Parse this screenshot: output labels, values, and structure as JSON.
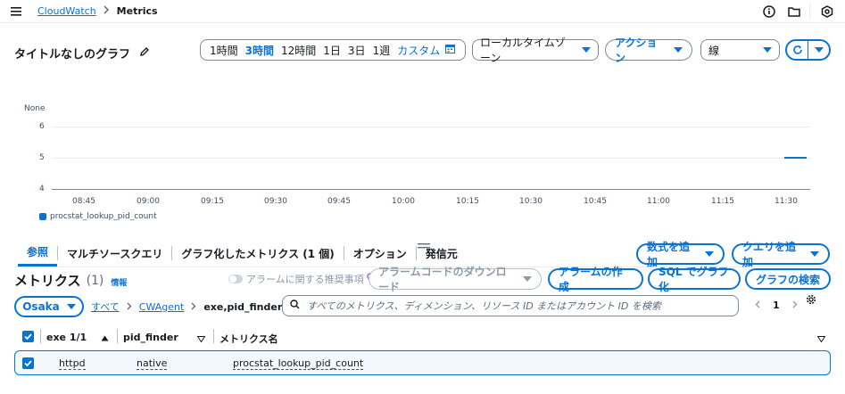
{
  "breadcrumb": {
    "root": "CloudWatch",
    "current": "Metrics"
  },
  "graph": {
    "title": "タイトルなしのグラフ",
    "time_ranges": [
      "1時間",
      "3時間",
      "12時間",
      "1日",
      "3日",
      "1週"
    ],
    "active_range": "3時間",
    "custom_label": "カスタム",
    "timezone": "ローカルタイムゾーン",
    "actions_label": "アクション",
    "chart_type": "線"
  },
  "chart_data": {
    "type": "line",
    "ylabel": "None",
    "y_ticks": [
      "6",
      "5",
      "4"
    ],
    "ylim": [
      4,
      6
    ],
    "x_ticks": [
      "08:45",
      "09:00",
      "09:15",
      "09:30",
      "09:45",
      "10:00",
      "10:15",
      "10:30",
      "10:45",
      "11:00",
      "11:15",
      "11:30"
    ],
    "series": [
      {
        "name": "procstat_lookup_pid_count",
        "color": "#0972d3",
        "points": [
          {
            "x": "11:31",
            "y": 5
          },
          {
            "x": "11:36",
            "y": 5
          }
        ]
      }
    ],
    "legend_placement": "bottom-left",
    "grid": true
  },
  "tabs": [
    {
      "label": "参照"
    },
    {
      "label": "マルチソースクエリ"
    },
    {
      "label": "グラフ化したメトリクス (1 個)"
    },
    {
      "label": "オプション"
    },
    {
      "label": "発信元"
    }
  ],
  "tab_actions": {
    "add_math": "数式を追加",
    "add_query": "クエリを追加"
  },
  "metrics": {
    "heading": "メトリクス",
    "count": "(1)",
    "info": "情報",
    "alarm_toggle_label": "アラームに関する推奨事項",
    "download_alarm_code": "アラームコードのダウンロード",
    "create_alarm": "アラームの作成",
    "sql_graph": "SQL でグラフ化",
    "search_graphs": "グラフの検索",
    "region": "Osaka",
    "crumbs": {
      "all": "すべて",
      "namespace": "CWAgent",
      "dimension": "exe,pid_finder"
    },
    "search_placeholder": "すべてのメトリクス、ディメンション、リソース ID またはアカウント ID を検索",
    "page": "1",
    "columns": [
      "exe 1/1",
      "pid_finder",
      "メトリクス名"
    ],
    "rows": [
      {
        "exe": "httpd",
        "pid_finder": "native",
        "metric": "procstat_lookup_pid_count"
      }
    ]
  },
  "colors": {
    "accent": "#0972d3",
    "selected_row_bg": "#f2f8fd"
  }
}
